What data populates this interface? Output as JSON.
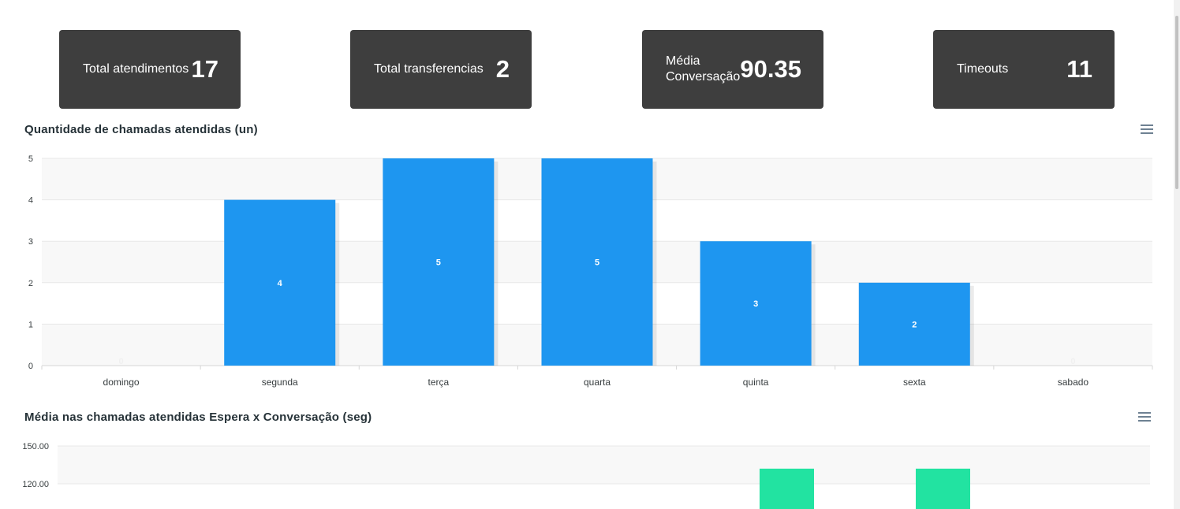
{
  "cards": [
    {
      "label": "Total atendimentos",
      "value": "17"
    },
    {
      "label": "Total transferencias",
      "value": "2"
    },
    {
      "label": "Média Conversação",
      "value": "90.35"
    },
    {
      "label": "Timeouts",
      "value": "11"
    }
  ],
  "colors": {
    "card_bg": "#3e3e3e",
    "bar_blue": "#1e96f0",
    "bar_green": "#22e3a1"
  },
  "icons": {
    "chart_menu": "hamburger-menu-icon"
  },
  "chart_data": [
    {
      "type": "bar",
      "title": "Quantidade de chamadas atendidas (un)",
      "categories": [
        "domingo",
        "segunda",
        "terça",
        "quarta",
        "quinta",
        "sexta",
        "sabado"
      ],
      "values": [
        0,
        4,
        5,
        5,
        3,
        2,
        0
      ],
      "data_labels": [
        "0",
        "4",
        "5",
        "5",
        "3",
        "2",
        "0"
      ],
      "ylim": [
        0,
        5
      ],
      "yticks": [
        "0",
        "1",
        "2",
        "3",
        "4",
        "5"
      ],
      "grid": true
    },
    {
      "type": "bar",
      "title": "Média nas chamadas atendidas Espera x Conversação (seg)",
      "yticks_visible": [
        "150.00",
        "120.00"
      ],
      "visible_bars": [
        {
          "value": 132
        },
        {
          "value": 132
        }
      ],
      "grid": true
    }
  ]
}
